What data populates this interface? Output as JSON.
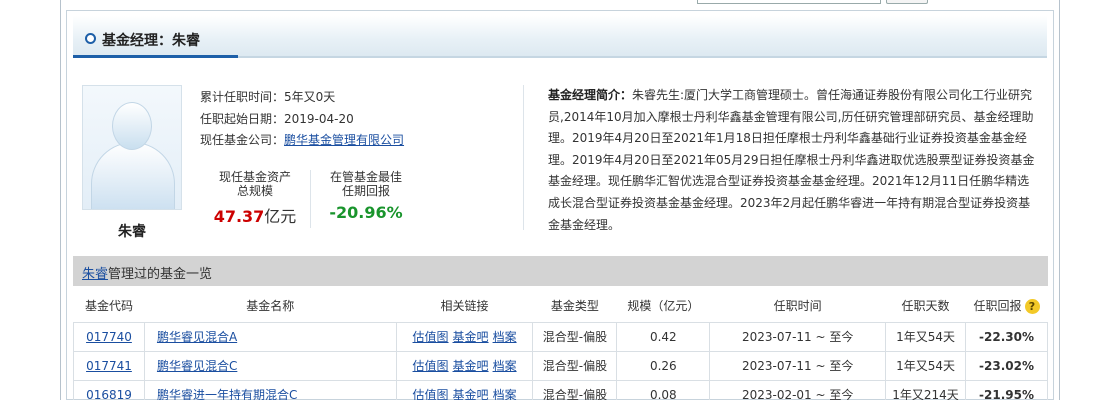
{
  "header": {
    "title": "基金经理：朱睿"
  },
  "manager": {
    "name": "朱睿",
    "tenure_total": "累计任职时间：5年又0天",
    "start_date": "任职起始日期：2019-04-20",
    "company_label": "现任基金公司：",
    "company": "鹏华基金管理有限公司"
  },
  "stats": {
    "aum_label_line1": "现任基金资产",
    "aum_label_line2": "总规模",
    "aum_value": "47.37",
    "aum_unit": "亿元",
    "best_label_line1": "在管基金最佳",
    "best_label_line2": "任期回报",
    "best_value": "-20.96%"
  },
  "bio": {
    "label": "基金经理简介：",
    "text": "朱睿先生:厦门大学工商管理硕士。曾任海通证券股份有限公司化工行业研究员,2014年10月加入摩根士丹利华鑫基金管理有限公司,历任研究管理部研究员、基金经理助理。2019年4月20日至2021年1月18日担任摩根士丹利华鑫基础行业证券投资基金基金经理。2019年4月20日至2021年05月29日担任摩根士丹利华鑫进取优选股票型证券投资基金基金经理。现任鹏华汇智优选混合型证券投资基金基金经理。2021年12月11日任鹏华精选成长混合型证券投资基金基金经理。2023年2月起任鹏华睿进一年持有期混合型证券投资基金基金经理。"
  },
  "fund_list": {
    "title_link": "朱睿",
    "title_rest": "管理过的基金一览",
    "columns": [
      "基金代码",
      "基金名称",
      "相关链接",
      "基金类型",
      "规模（亿元）",
      "任职时间",
      "任职天数",
      "任职回报"
    ],
    "help_icon_text": "?",
    "rows": [
      {
        "code": "017740",
        "name": "鹏华睿见混合A",
        "links": [
          "估值图",
          "基金吧",
          "档案"
        ],
        "type": "混合型-偏股",
        "size": "0.42",
        "period": "2023-07-11 ~ 至今",
        "days": "1年又54天",
        "return": "-22.30%"
      },
      {
        "code": "017741",
        "name": "鹏华睿见混合C",
        "links": [
          "估值图",
          "基金吧",
          "档案"
        ],
        "type": "混合型-偏股",
        "size": "0.26",
        "period": "2023-07-11 ~ 至今",
        "days": "1年又54天",
        "return": "-23.02%"
      },
      {
        "code": "016819",
        "name": "鹏华睿进一年持有期混合C",
        "links": [
          "估值图",
          "基金吧",
          "档案"
        ],
        "type": "混合型-偏股",
        "size": "0.08",
        "period": "2023-02-01 ~ 至今",
        "days": "1年又214天",
        "return": "-21.95%"
      }
    ]
  },
  "colors": {
    "accent": "#1d5fa8",
    "aum_value": "#cc0000",
    "return_value": "#19942c"
  }
}
